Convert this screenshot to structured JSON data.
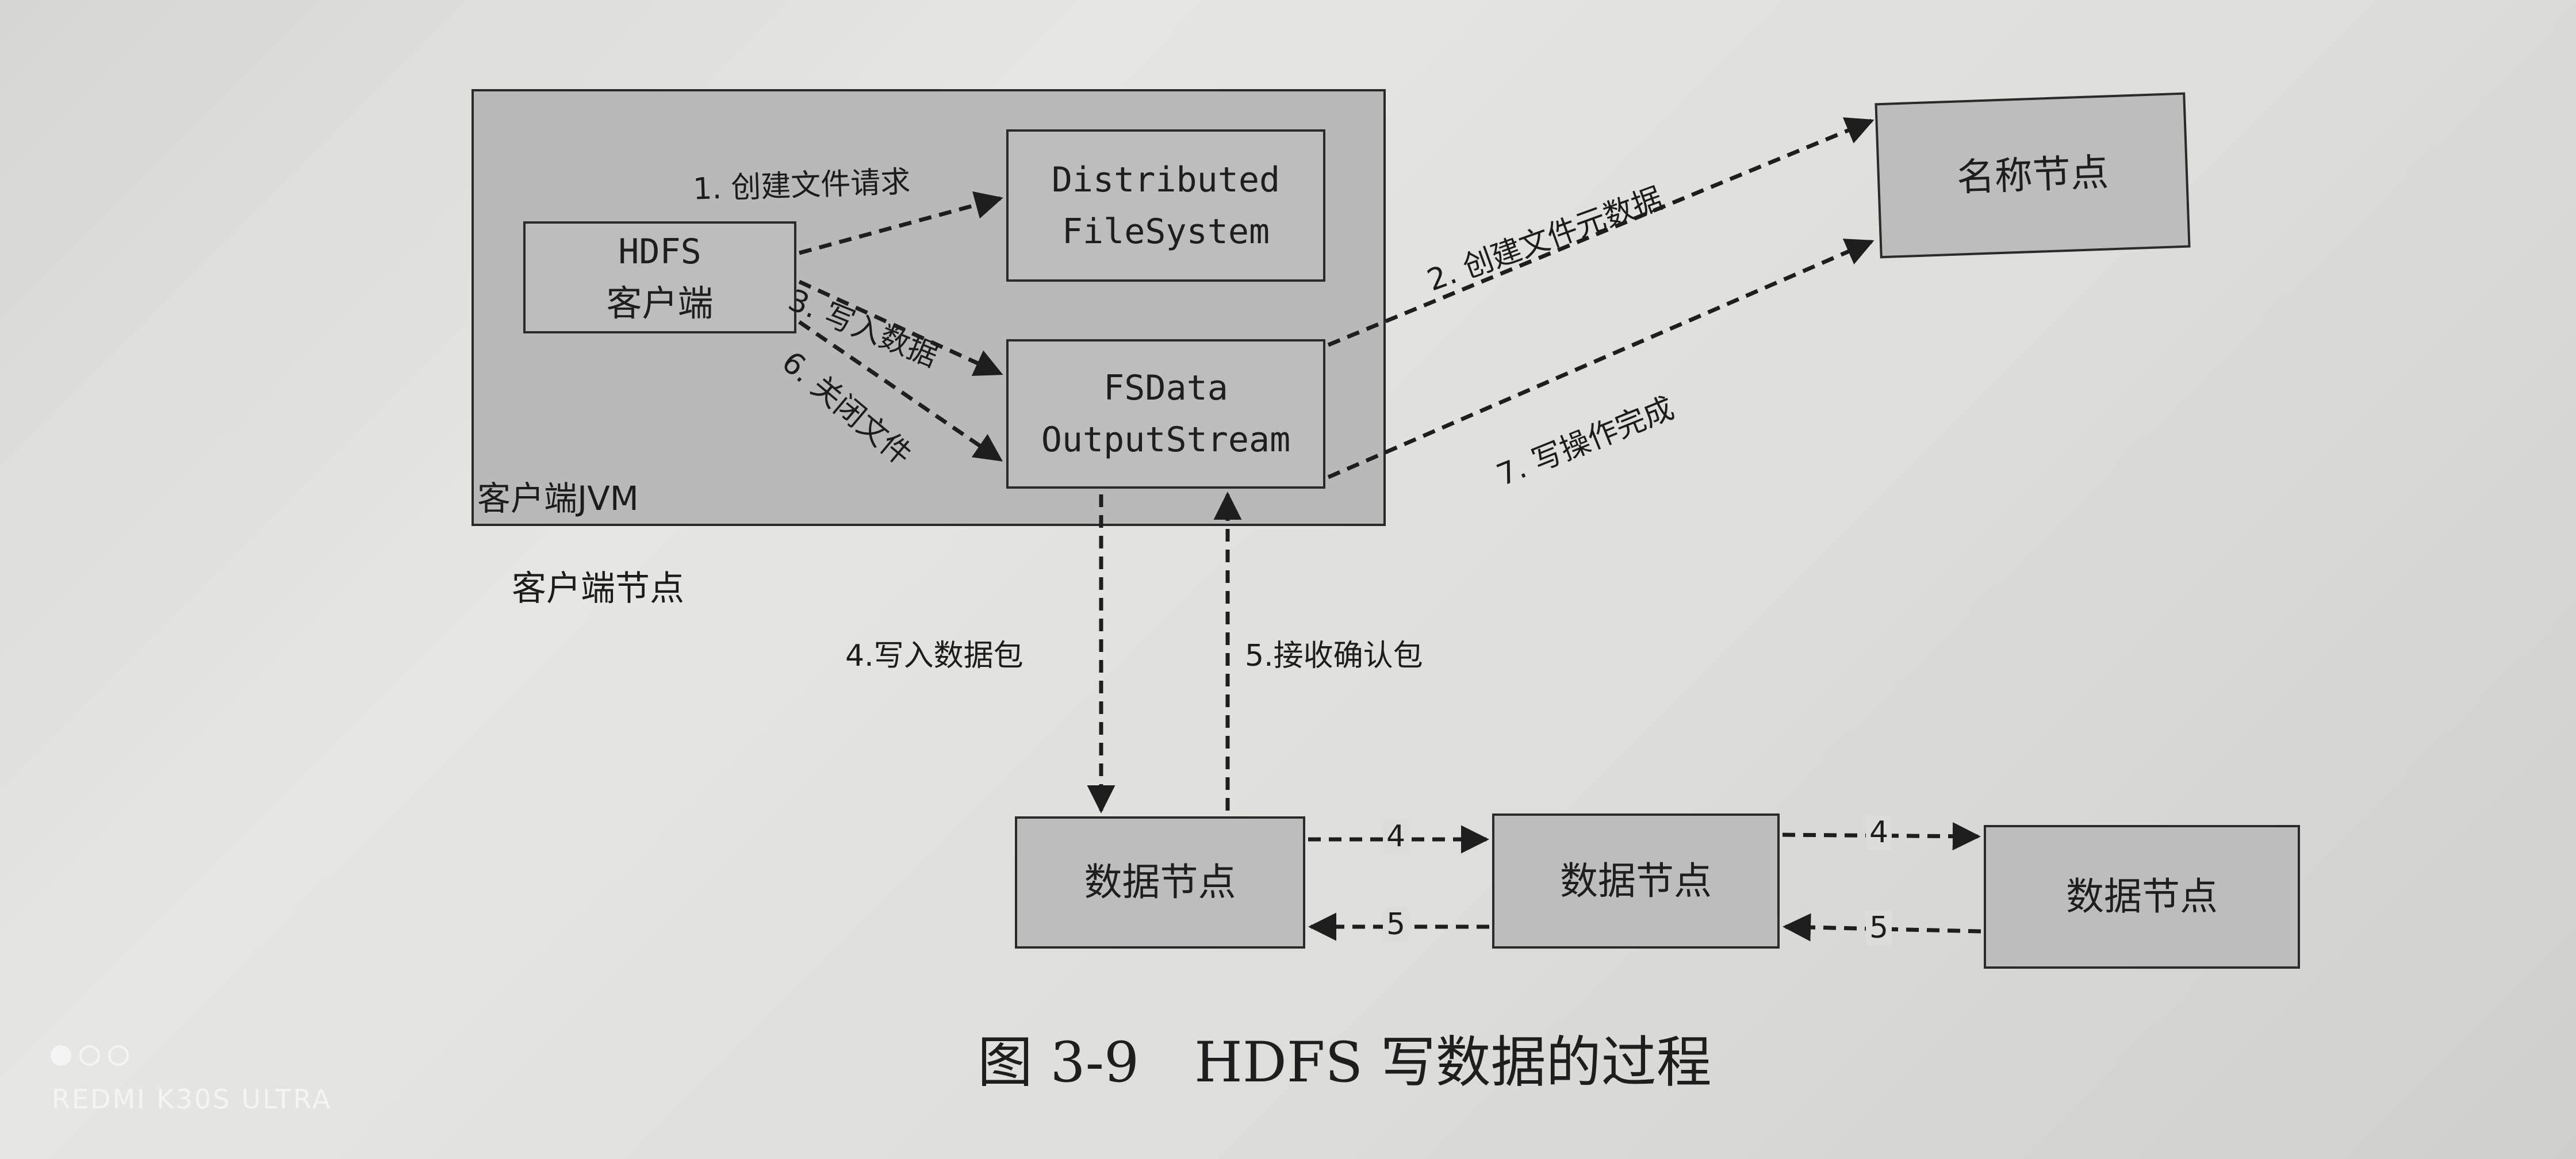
{
  "jvm_label": "客户端JVM",
  "client_node_label": "客户端节点",
  "hdfs_client": {
    "line1": "HDFS",
    "line2": "客户端"
  },
  "distributed_fs": {
    "line1": "Distributed",
    "line2": "FileSystem"
  },
  "fsdata": {
    "line1": "FSData",
    "line2": "OutputStream"
  },
  "name_node": "名称节点",
  "data_nodes": [
    "数据节点",
    "数据节点",
    "数据节点"
  ],
  "steps": {
    "s1": "1. 创建文件请求",
    "s2": "2. 创建文件元数据",
    "s3": "3. 写入数据",
    "s4": "4.写入数据包",
    "s5": "5.接收确认包",
    "s6": "6. 关闭文件",
    "s7": "7. 写操作完成",
    "pipe4a": "4",
    "pipe4b": "4",
    "pipe5a": "5",
    "pipe5b": "5"
  },
  "caption": "图 3-9　HDFS 写数据的过程",
  "watermark": "REDMI K30S ULTRA"
}
